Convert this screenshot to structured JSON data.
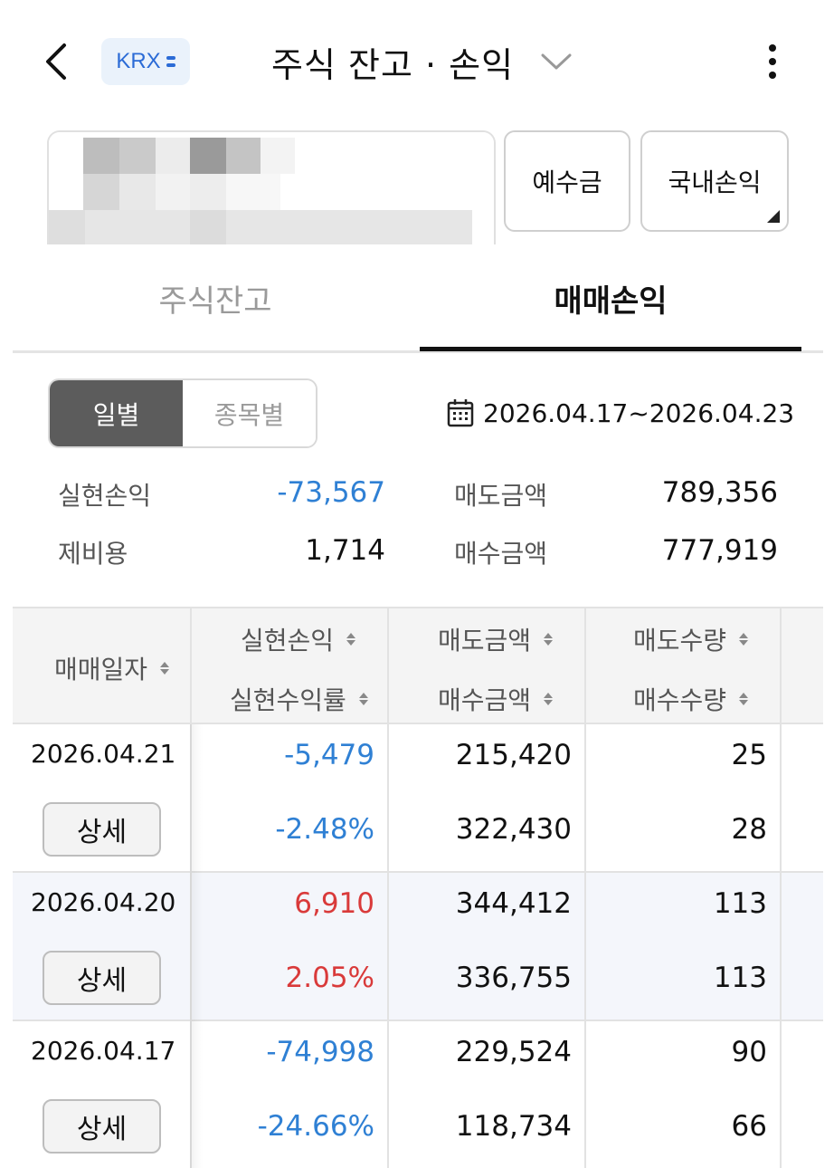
{
  "header": {
    "badge": "KRX",
    "title": "주식 잔고 · 손익"
  },
  "account": {
    "deposit_label": "예수금",
    "domestic_pl_label": "국내손익"
  },
  "tabs": [
    {
      "label": "주식잔고",
      "active": false
    },
    {
      "label": "매매손익",
      "active": true
    }
  ],
  "segment": {
    "daily": "일별",
    "by_item": "종목별"
  },
  "date_range": "2026.04.17~2026.04.23",
  "summary": {
    "realized_pl_label": "실현손익",
    "realized_pl_value": "-73,567",
    "fees_label": "제비용",
    "fees_value": "1,714",
    "sell_amount_label": "매도금액",
    "sell_amount_value": "789,356",
    "buy_amount_label": "매수금액",
    "buy_amount_value": "777,919"
  },
  "table": {
    "headers": {
      "trade_date": "매매일자",
      "realized_pl": "실현손익",
      "realized_rate": "실현수익률",
      "sell_amount": "매도금액",
      "buy_amount": "매수금액",
      "sell_qty": "매도수량",
      "buy_qty": "매수수량"
    },
    "detail_label": "상세",
    "rows": [
      {
        "date": "2026.04.21",
        "pl": "-5,479",
        "rate": "-2.48%",
        "sell_amount": "215,420",
        "buy_amount": "322,430",
        "sell_qty": "25",
        "buy_qty": "28"
      },
      {
        "date": "2026.04.20",
        "pl": "6,910",
        "rate": "2.05%",
        "sell_amount": "344,412",
        "buy_amount": "336,755",
        "sell_qty": "113",
        "buy_qty": "113"
      },
      {
        "date": "2026.04.17",
        "pl": "-74,998",
        "rate": "-24.66%",
        "sell_amount": "229,524",
        "buy_amount": "118,734",
        "sell_qty": "90",
        "buy_qty": "66"
      }
    ]
  },
  "colors": {
    "loss": "#2f80d4",
    "gain": "#d93a3a",
    "badge_text": "#2b6bd6"
  },
  "icons": [
    "back-chevron-icon",
    "krx-lines-icon",
    "chevron-down-icon",
    "more-vertical-icon",
    "calendar-icon",
    "sort-icon"
  ]
}
